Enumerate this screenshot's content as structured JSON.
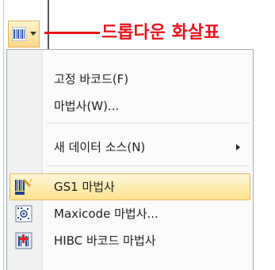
{
  "callout": {
    "label": "드롭다운 화살표",
    "color": "#e8131c"
  },
  "dropdown_button": {
    "icon": "barcode-icon"
  },
  "menu": {
    "items": [
      {
        "label": "고정 바코드(F)",
        "has_submenu": false
      },
      {
        "label": "마법사(W)...",
        "has_submenu": false
      },
      {
        "label": "새 데이터 소스(N)",
        "has_submenu": true
      },
      {
        "label": "GS1 마법사",
        "icon": "gs1-barcode-icon",
        "selected": true
      },
      {
        "label": "Maxicode 마법사...",
        "icon": "maxicode-icon"
      },
      {
        "label": "HIBC 바코드 마법사",
        "icon": "hibc-barcode-icon"
      }
    ]
  },
  "colors": {
    "highlight": "#ffe38f",
    "highlight_border": "#e6b95e",
    "callout": "#e8131c"
  }
}
